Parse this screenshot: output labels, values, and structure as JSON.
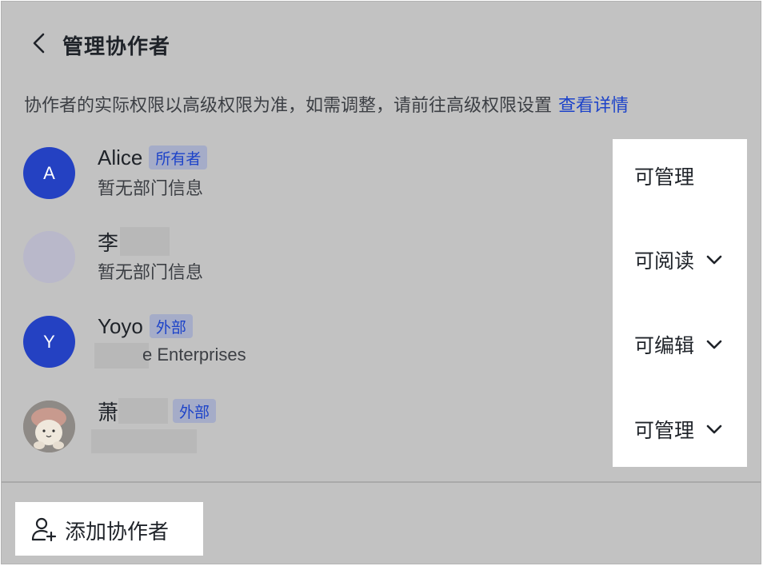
{
  "header": {
    "title": "管理协作者",
    "back_icon": "chevron-left-icon"
  },
  "notice": {
    "text": "协作者的实际权限以高级权限为准，如需调整，请前往高级权限设置",
    "link": "查看详情"
  },
  "colors": {
    "overlay": "#c2c2c2",
    "accent": "#1d43c9",
    "avatar_blue": "#2441c2",
    "badge_bg": "#a5acc8"
  },
  "members": [
    {
      "avatar_text": "A",
      "name": "Alice",
      "badge": "所有者",
      "subtitle": "暂无部门信息",
      "permission": "可管理",
      "has_dropdown": false
    },
    {
      "avatar_text": "",
      "name": "李",
      "badge": "",
      "subtitle": "暂无部门信息",
      "permission": "可阅读",
      "has_dropdown": true
    },
    {
      "avatar_text": "Y",
      "name": "Yoyo",
      "badge": "外部",
      "subtitle": "e Enterprises",
      "permission": "可编辑",
      "has_dropdown": true
    },
    {
      "avatar_text": "",
      "name": "萧",
      "badge": "外部",
      "subtitle": "",
      "permission": "可管理",
      "has_dropdown": true
    }
  ],
  "footer": {
    "add_label": "添加协作者",
    "add_icon": "add-user-icon"
  }
}
